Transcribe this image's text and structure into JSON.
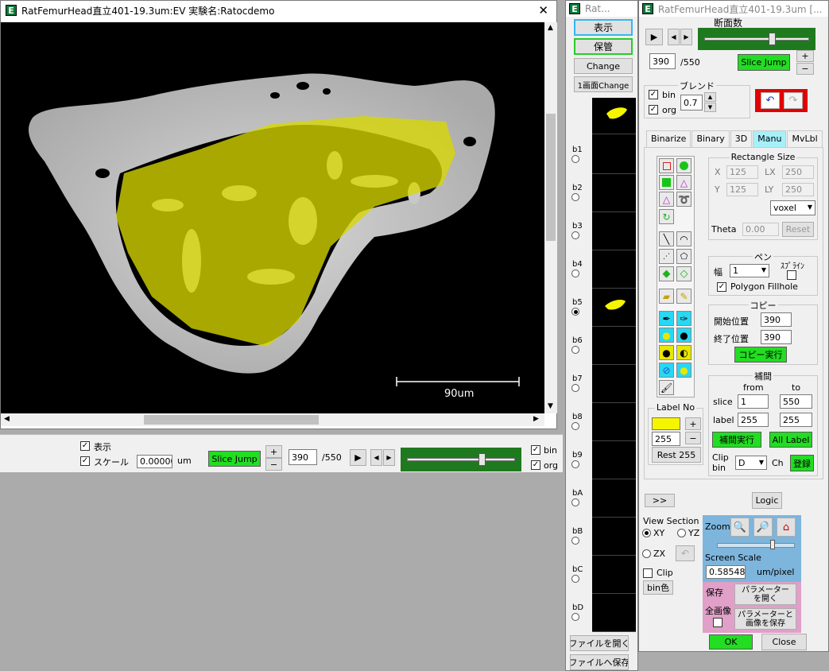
{
  "image_window": {
    "title": "RatFemurHead直立401-19.3um:EV 実験名:Ratocdemo",
    "scale_label": "90um"
  },
  "bottom_bar": {
    "show_label": "表示",
    "scale_label": "スケール",
    "scale_value": "0.00000",
    "scale_unit": "um",
    "slice_jump": "Slice Jump",
    "plus": "+",
    "minus": "−",
    "slice_value": "390",
    "slice_total": "/550",
    "bin_label": "bin",
    "org_label": "org",
    "slider_fraction": 0.71
  },
  "mid_window": {
    "title": "Rat...",
    "show_button": "表示",
    "save_button": "保管",
    "change_button": "Change",
    "one_screen_change": "1画面Change",
    "bins": [
      "b1",
      "b2",
      "b3",
      "b4",
      "b5",
      "b6",
      "b7",
      "b8",
      "b9",
      "bA",
      "bB",
      "bC",
      "bD"
    ],
    "selected_bin": "b5",
    "open_file": "ファイルを開く",
    "save_file": "ファイルへ保存"
  },
  "control_window": {
    "title": "RatFemurHead直立401-19.3um [...",
    "sections_label": "断面数",
    "slice_value": "390",
    "slice_total": "/550",
    "slice_jump": "Slice Jump",
    "plus": "+",
    "minus": "−",
    "slider_fraction": 0.66,
    "blend_label": "ブレンド",
    "bin_label": "bin",
    "org_label": "org",
    "blend_value": "0.7",
    "tabs": [
      "Binarize",
      "Binary",
      "3D",
      "Manu",
      "MvLbl"
    ],
    "active_tab": "Manu",
    "label_no_title": "Label No",
    "label_no_value": "255",
    "rest_button": "Rest 255",
    "rect_size_title": "Rectangle Size",
    "x_label": "X",
    "x_value": "125",
    "lx_label": "LX",
    "lx_value": "250",
    "y_label": "Y",
    "y_value": "125",
    "ly_label": "LY",
    "ly_value": "250",
    "unit_select": "voxel",
    "theta_label": "Theta",
    "theta_value": "0.00",
    "reset_button": "Reset",
    "pen_title": "ペン",
    "spline_label": "ｽﾌﾟﾗｲﾝ",
    "width_label": "幅",
    "width_value": "1",
    "polygon_fillhole": "Polygon Fillhole",
    "copy_title": "コピー",
    "start_label": "開始位置",
    "start_value": "390",
    "end_label": "終了位置",
    "end_value": "390",
    "copy_exec": "コピー実行",
    "interp_title": "補間",
    "from_label": "from",
    "to_label": "to",
    "slice_label": "slice",
    "slice_from": "1",
    "slice_to": "550",
    "label_label": "label",
    "label_from": "255",
    "label_to": "255",
    "interp_exec": "補間実行",
    "all_label": "All Label",
    "clip_bin_label1": "Clip",
    "clip_bin_label2": "bin",
    "clip_select": "D",
    "ch_label": "Ch",
    "register_button": "登録",
    "expand_button": ">>",
    "logic_button": "Logic",
    "view_section_label": "View Section",
    "xy_label": "XY",
    "yz_label": "YZ",
    "zx_label": "ZX",
    "clip_label": "Clip",
    "bin_color_button": "bin色",
    "zoom_label": "Zoom",
    "screen_scale_label": "Screen Scale",
    "screen_scale_value": "0.585480",
    "screen_scale_unit": "um/pixel",
    "save_label": "保存",
    "all_image_label": "全画像",
    "open_params": "パラメーター\nを開く",
    "save_params": "パラメーターと\n画像を保存",
    "ok_button": "OK",
    "close_button": "Close"
  }
}
